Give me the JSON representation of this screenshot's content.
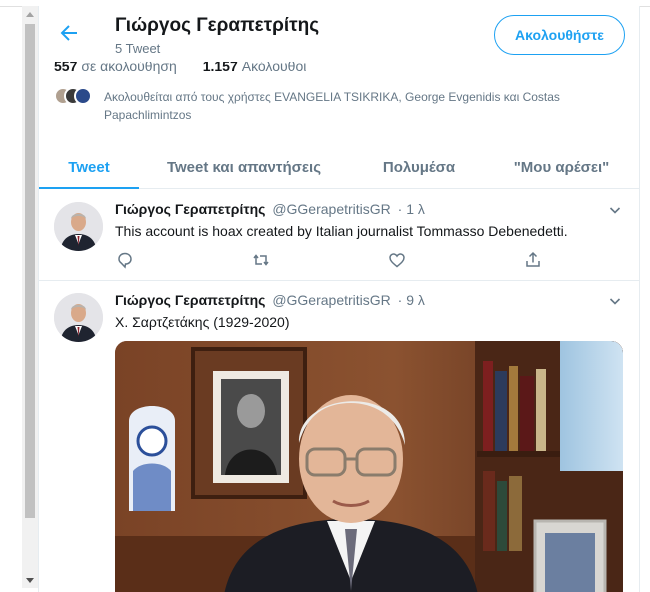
{
  "header": {
    "title": "Γιώργος Γεραπετρίτης",
    "tweet_count": "5 Tweet",
    "follow_label": "Ακολουθήστε"
  },
  "stats": {
    "following_count": "557",
    "following_label": "σε ακολούθηση",
    "followers_count": "1.157",
    "followers_label": "Ακόλουθοι"
  },
  "followed_by": "Ακολουθείται από τους χρήστες EVANGELIA TSIKRIKA, George Evgenidis και Costas Papachlimintzos",
  "tabs": [
    {
      "label": "Tweet"
    },
    {
      "label": "Tweet και απαντήσεις"
    },
    {
      "label": "Πολυμέσα"
    },
    {
      "label": "\"Μου αρέσει\""
    }
  ],
  "tweets": [
    {
      "name": "Γιώργος Γεραπετρίτης",
      "handle": "@GGerapetritisGR",
      "time": "· 1 λ",
      "text": "This account is hoax created by Italian journalist Tommasso Debenedetti."
    },
    {
      "name": "Γιώργος Γεραπετρίτης",
      "handle": "@GGerapetritisGR",
      "time": "· 9 λ",
      "text": "Χ. Σαρτζετάκης (1929-2020)"
    }
  ],
  "colors": {
    "accent": "#1da1f2",
    "secondary_text": "#657786",
    "border": "#e6ecf0"
  }
}
